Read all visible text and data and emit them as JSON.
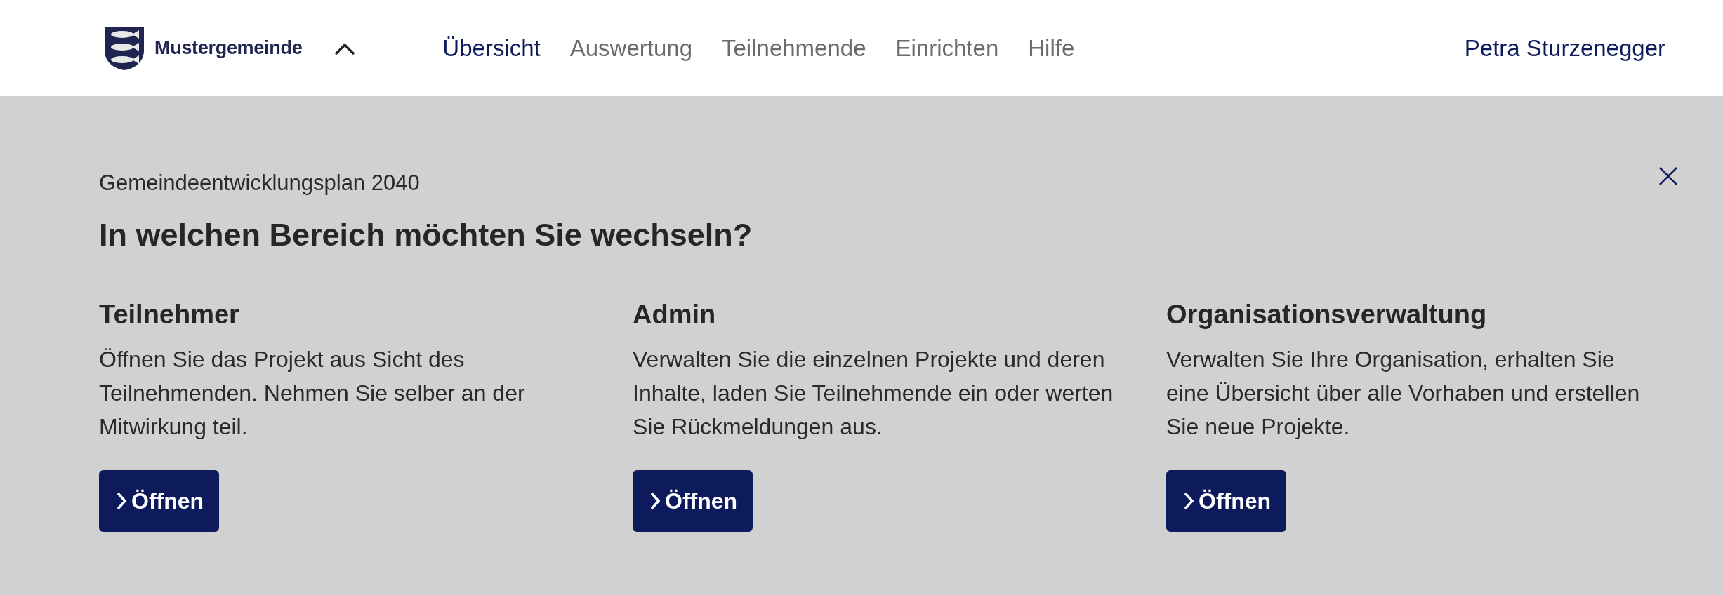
{
  "header": {
    "brand": "Mustergemeinde",
    "switcher_expanded": true,
    "nav": [
      {
        "label": "Übersicht",
        "selected": true
      },
      {
        "label": "Auswertung",
        "selected": false
      },
      {
        "label": "Teilnehmende",
        "selected": false
      },
      {
        "label": "Einrichten",
        "selected": false
      },
      {
        "label": "Hilfe",
        "selected": false
      }
    ],
    "user": "Petra Sturzenegger"
  },
  "panel": {
    "subtitle": "Gemeindeentwicklungsplan 2040",
    "title": "In welchen Bereich möchten Sie wechseln?",
    "areas": [
      {
        "title": "Teilnehmer",
        "text": "Öffnen Sie das Projekt aus Sicht des Teilnehmenden. Nehmen Sie selber an der Mitwirkung teil.",
        "button": "Öffnen"
      },
      {
        "title": "Admin",
        "text": "Verwalten Sie die einzelnen Projekte und deren Inhalte, laden Sie Teilnehmende ein oder werten Sie Rückmeldungen aus.",
        "button": "Öffnen"
      },
      {
        "title": "Organisationsverwaltung",
        "text": "Verwalten Sie Ihre Organisation, erhalten Sie eine Übersicht über alle Vorhaben und erstellen Sie neue Projekte.",
        "button": "Öffnen"
      }
    ]
  }
}
